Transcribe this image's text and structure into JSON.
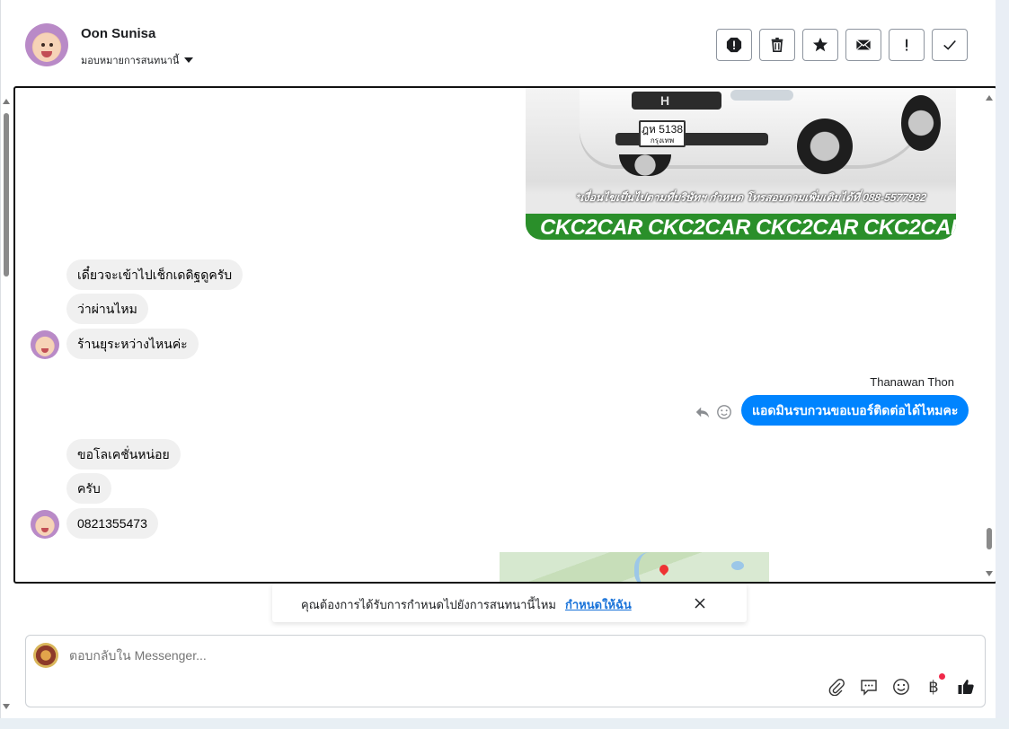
{
  "header": {
    "contact_name": "Oon Sunisa",
    "assign_label": "มอบหมายการสนทนานี้",
    "actions": [
      {
        "name": "report-spam-button",
        "icon": "alert-octagon-icon"
      },
      {
        "name": "delete-button",
        "icon": "trash-icon"
      },
      {
        "name": "star-button",
        "icon": "star-icon"
      },
      {
        "name": "mark-unread-button",
        "icon": "envelope-icon"
      },
      {
        "name": "important-button",
        "icon": "exclamation-icon"
      },
      {
        "name": "mark-done-button",
        "icon": "check-icon"
      }
    ]
  },
  "chat": {
    "car_image": {
      "plate_text": "ฎห 5138",
      "plate_sub": "กรุงเทพ",
      "disclaimer": "*เงื่อนไขเป็นไปตามที่บริษัทฯ กำหนด โทรสอบถามเพิ่มเติมได้ที่ 088-5577932",
      "banner": "CKC2CAR CKC2CAR CKC2CAR CKC2CAR CKC2CAR CKC2"
    },
    "incoming_1": [
      "เดี๋ยวจะเข้าไปเช็กเดดิฐดูครับ",
      "ว่าผ่านไหม",
      "ร้านยุระหว่างไหนค่ะ"
    ],
    "outgoing_sender": "Thanawan Thon",
    "outgoing_message": "แอดมินรบกวนขอเบอร์ติดต่อได้ไหมคะ",
    "incoming_2": [
      "ขอโลเคชั่นหน่อย",
      "ครับ",
      "0821355473"
    ]
  },
  "prompt": {
    "text": "คุณต้องการได้รับการกำหนดไปยังการสนทนานี้ไหม",
    "link": "กำหนดให้ฉัน"
  },
  "composer": {
    "placeholder": "ตอบกลับใน Messenger...",
    "tools": [
      "paperclip-icon",
      "speech-bubble-icon",
      "emoji-icon",
      "baht-icon",
      "thumbs-up-icon"
    ],
    "baht_symbol": "฿",
    "like_color": "#1c1e21"
  },
  "colors": {
    "outgoing_bubble": "#0084ff",
    "incoming_bubble": "#f0f0f0",
    "link": "#1a73d9",
    "banner_green": "#2a8f2a"
  }
}
